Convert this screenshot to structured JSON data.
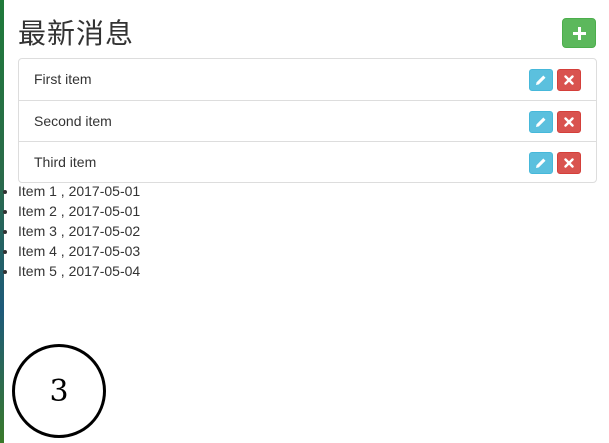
{
  "header": {
    "title": "最新消息",
    "add_button_icon": "plus-icon",
    "add_button_color": "#5cb85c"
  },
  "list": {
    "items": [
      {
        "label": "First item"
      },
      {
        "label": "Second item"
      },
      {
        "label": "Third item"
      }
    ],
    "edit_icon": "pencil-icon",
    "delete_icon": "close-icon",
    "edit_color": "#5bc0de",
    "delete_color": "#d9534f"
  },
  "bullets": [
    "Item 1 , 2017-05-01",
    "Item 2 , 2017-05-01",
    "Item 3 , 2017-05-02",
    "Item 4 , 2017-05-03",
    "Item 5 , 2017-05-04"
  ],
  "counter": {
    "value": "3"
  }
}
